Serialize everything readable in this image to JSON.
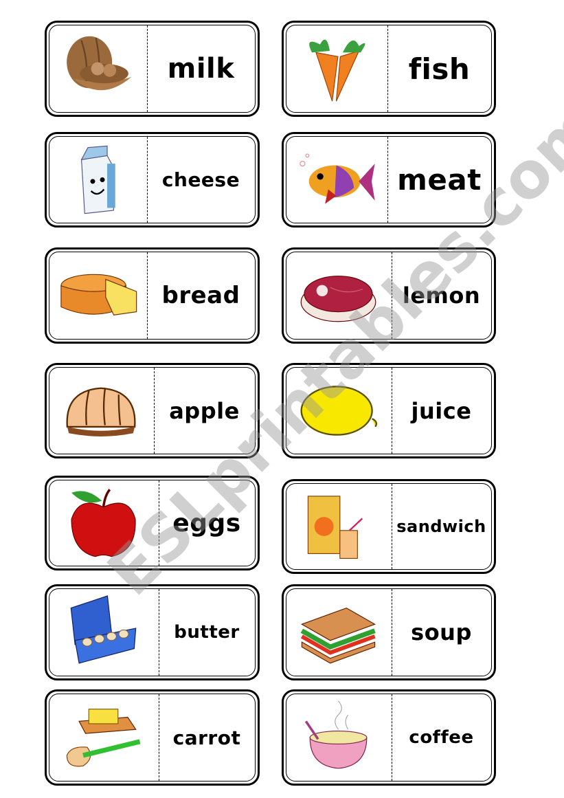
{
  "watermark": "ESLprintables.com",
  "cards": [
    {
      "icon": "walnut-icon",
      "word": "milk"
    },
    {
      "icon": "carrot-icon",
      "word": "fish"
    },
    {
      "icon": "milk-carton-icon",
      "word": "cheese"
    },
    {
      "icon": "fish-icon",
      "word": "meat"
    },
    {
      "icon": "cheese-icon",
      "word": "bread"
    },
    {
      "icon": "meat-icon",
      "word": "lemon"
    },
    {
      "icon": "bread-icon",
      "word": "apple"
    },
    {
      "icon": "lemon-icon",
      "word": "juice"
    },
    {
      "icon": "apple-icon",
      "word": "eggs"
    },
    {
      "icon": "juice-icon",
      "word": "sandwich"
    },
    {
      "icon": "egg-carton-icon",
      "word": "butter"
    },
    {
      "icon": "sandwich-icon",
      "word": "soup"
    },
    {
      "icon": "butter-icon",
      "word": "carrot"
    },
    {
      "icon": "soup-icon",
      "word": "coffee"
    }
  ]
}
